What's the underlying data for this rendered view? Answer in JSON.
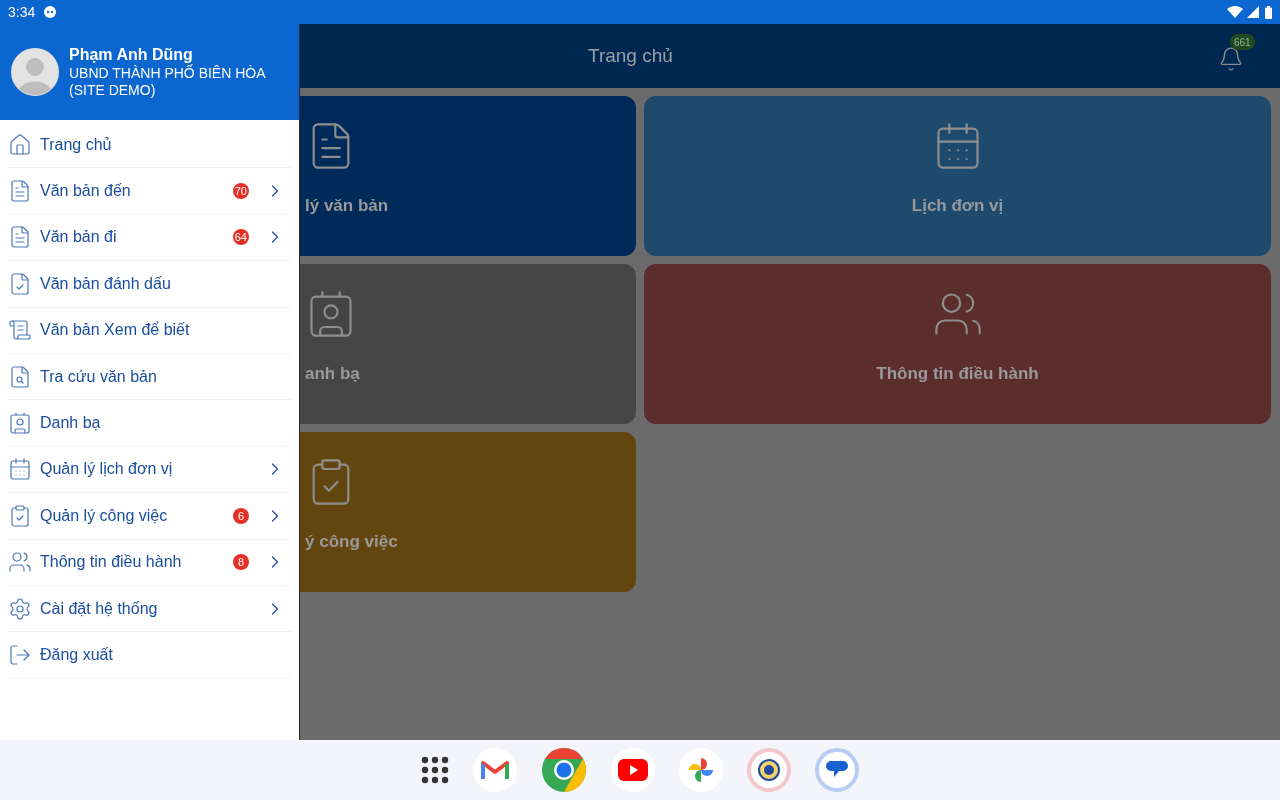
{
  "status_bar": {
    "time": "3:34"
  },
  "drawer": {
    "user": {
      "name": "Phạm Anh Dũng",
      "org": "UBND THÀNH PHỐ BIÊN HÒA (SITE DEMO)"
    },
    "items": [
      {
        "kind": "home",
        "label": "Trang chủ",
        "has_children": false
      },
      {
        "kind": "document",
        "label": "Văn bản đến",
        "badge": "70",
        "has_children": true
      },
      {
        "kind": "document",
        "label": "Văn bản đi",
        "badge": "64",
        "has_children": true
      },
      {
        "kind": "star-document",
        "label": "Văn bản đánh dấu",
        "has_children": false
      },
      {
        "kind": "list-document",
        "label": "Văn bản Xem để biết",
        "has_children": false
      },
      {
        "kind": "search-document",
        "label": "Tra cứu văn bản",
        "has_children": false
      },
      {
        "kind": "contact",
        "label": "Danh bạ",
        "has_children": false
      },
      {
        "kind": "calendar",
        "label": "Quản lý lịch đơn vị",
        "has_children": true
      },
      {
        "kind": "task",
        "label": "Quản lý công việc",
        "badge": "6",
        "has_children": true
      },
      {
        "kind": "people",
        "label": "Thông tin điều hành",
        "badge": "8",
        "has_children": true
      },
      {
        "kind": "settings",
        "label": "Cài đặt hệ thống",
        "has_children": true
      },
      {
        "kind": "logout",
        "label": "Đăng xuất",
        "has_children": false
      }
    ]
  },
  "app_bar": {
    "title": "Trang chủ",
    "notification_count": "661"
  },
  "tiles": [
    {
      "kind": "document",
      "label": "lý văn bản",
      "color": "#002a5a"
    },
    {
      "kind": "calendar",
      "label": "Lịch đơn vị",
      "color": "#1e4a6e"
    },
    {
      "kind": "contact",
      "label": "anh bạ",
      "color": "#454545"
    },
    {
      "kind": "people",
      "label": "Thông tin điều hành",
      "color": "#5c2d2d"
    },
    {
      "kind": "task",
      "label": "ý công việc",
      "color": "#634510"
    }
  ]
}
